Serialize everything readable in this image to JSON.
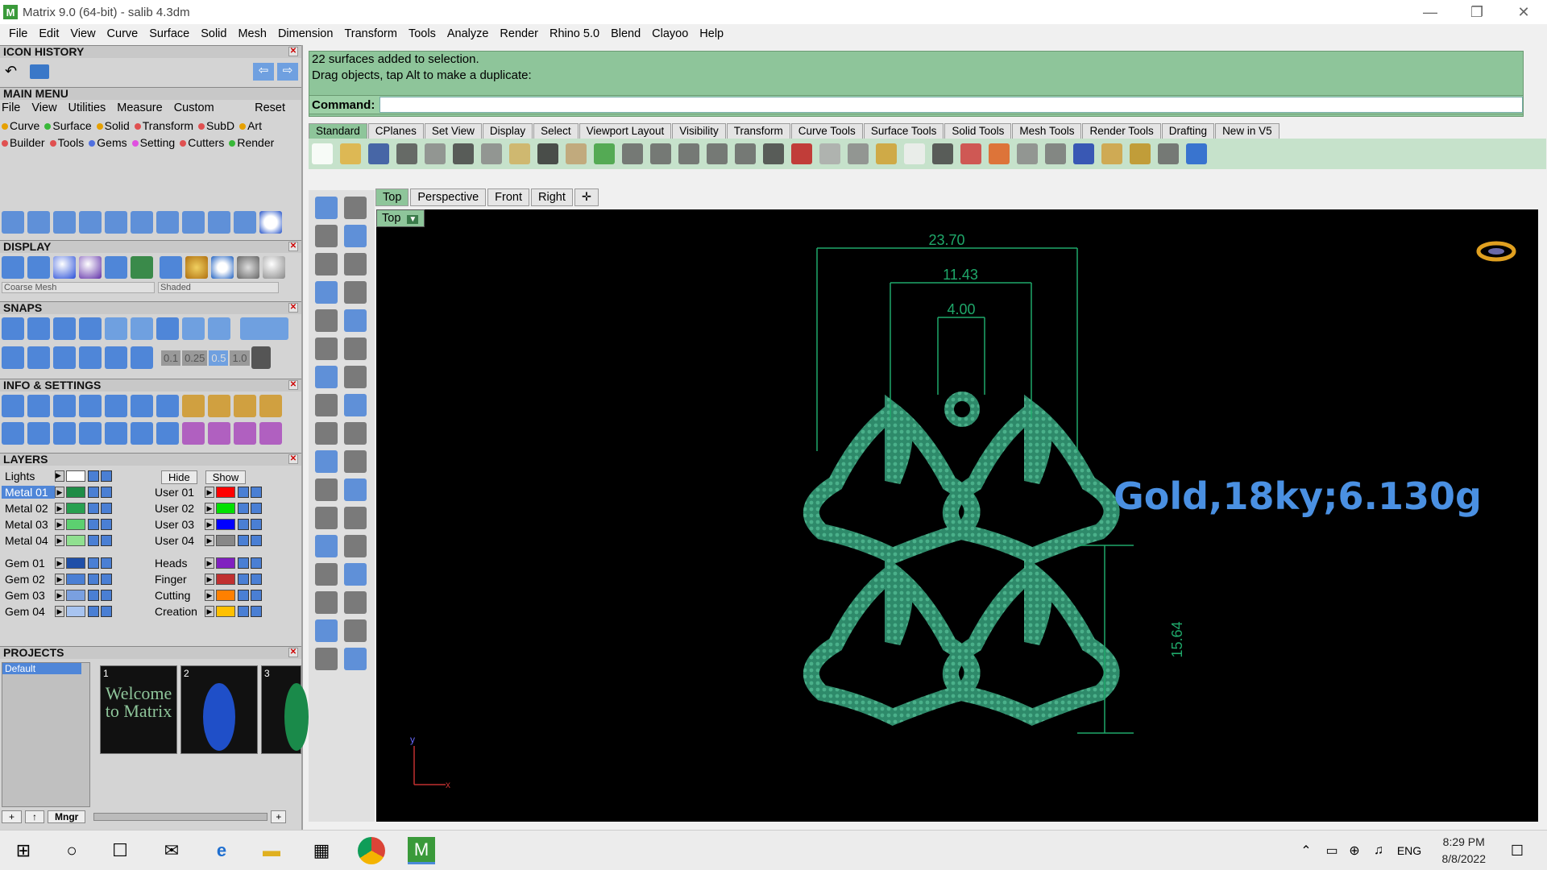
{
  "window": {
    "title": "Matrix 9.0 (64-bit) - salib 4.3dm",
    "minimize": "—",
    "restore": "❐",
    "close": "✕"
  },
  "menu": [
    "File",
    "Edit",
    "View",
    "Curve",
    "Surface",
    "Solid",
    "Mesh",
    "Dimension",
    "Transform",
    "Tools",
    "Analyze",
    "Render",
    "Rhino 5.0",
    "Blend",
    "Clayoo",
    "Help"
  ],
  "panels": {
    "icon_history": "ICON HISTORY",
    "main_menu": "MAIN MENU",
    "display": "DISPLAY",
    "snaps": "SNAPS",
    "info_settings": "INFO & SETTINGS",
    "layers": "LAYERS",
    "projects": "PROJECTS"
  },
  "main_menu_items": [
    "File",
    "View",
    "Utilities",
    "Measure",
    "Custom"
  ],
  "main_menu_reset": "Reset",
  "main_menu_categories_row1": [
    {
      "label": "Curve",
      "color": "#e6a000"
    },
    {
      "label": "Surface",
      "color": "#38b838"
    },
    {
      "label": "Solid",
      "color": "#e6a000"
    },
    {
      "label": "Transform",
      "color": "#e05050"
    },
    {
      "label": "SubD",
      "color": "#e05050"
    },
    {
      "label": "Art",
      "color": "#e6a000"
    }
  ],
  "main_menu_categories_row2": [
    {
      "label": "Builder",
      "color": "#e05050"
    },
    {
      "label": "Tools",
      "color": "#e05050"
    },
    {
      "label": "Gems",
      "color": "#5070e0"
    },
    {
      "label": "Setting",
      "color": "#e050e0"
    },
    {
      "label": "Cutters",
      "color": "#e05050"
    },
    {
      "label": "Render",
      "color": "#38b838"
    }
  ],
  "display": {
    "mesh_select": "Coarse Mesh",
    "mode_select": "Shaded"
  },
  "snaps": {
    "values": [
      "0.1",
      "0.25",
      "0.5",
      "1.0"
    ]
  },
  "layers": {
    "hide_label": "Hide",
    "show_label": "Show",
    "lights": {
      "name": "Lights",
      "color": "#ffffff"
    },
    "left": [
      {
        "name": "Metal 01",
        "color": "#1e8c46",
        "selected": true
      },
      {
        "name": "Metal 02",
        "color": "#28a050"
      },
      {
        "name": "Metal 03",
        "color": "#5cd070"
      },
      {
        "name": "Metal 04",
        "color": "#90e090"
      },
      {
        "name": "Gem 01",
        "color": "#1f4fa8"
      },
      {
        "name": "Gem 02",
        "color": "#4a7fd4"
      },
      {
        "name": "Gem 03",
        "color": "#7aa0e0"
      },
      {
        "name": "Gem 04",
        "color": "#a8c4f0"
      }
    ],
    "right": [
      {
        "name": "User 01",
        "color": "#ff0000"
      },
      {
        "name": "User 02",
        "color": "#00e000"
      },
      {
        "name": "User 03",
        "color": "#0000ff"
      },
      {
        "name": "User 04",
        "color": "#888888"
      },
      {
        "name": "Heads",
        "color": "#8020c0"
      },
      {
        "name": "Finger",
        "color": "#c03030"
      },
      {
        "name": "Cutting",
        "color": "#ff8000"
      },
      {
        "name": "Creation",
        "color": "#ffc000"
      }
    ]
  },
  "projects": {
    "list": [
      "Default"
    ],
    "thumb_numbers": [
      "1",
      "2",
      "3"
    ],
    "welcome_text": "Welcome to Matrix",
    "mngr": "Mngr"
  },
  "command": {
    "line1": "22 surfaces added to selection.",
    "line2": "Drag objects, tap Alt to make a duplicate:",
    "prompt": "Command:",
    "value": ""
  },
  "toolbar_tabs": [
    "Standard",
    "CPlanes",
    "Set View",
    "Display",
    "Select",
    "Viewport Layout",
    "Visibility",
    "Transform",
    "Curve Tools",
    "Surface Tools",
    "Solid Tools",
    "Mesh Tools",
    "Render Tools",
    "Drafting",
    "New in V5"
  ],
  "viewport_tabs": [
    "Top",
    "Perspective",
    "Front",
    "Right"
  ],
  "viewport": {
    "label": "Top",
    "dims": [
      "23.70",
      "11.43",
      "4.00",
      "15.64"
    ],
    "annotation": "Gold,18ky;6.130g",
    "axis_y": "y",
    "axis_x": "x"
  },
  "taskbar": {
    "time": "8:29 PM",
    "date": "8/8/2022",
    "lang": "ENG"
  },
  "colors": {
    "green_panel": "#8ec59a",
    "model_green": "#2e8a6a",
    "dim_green": "#1fa86a",
    "annotation_blue": "#4a90e2"
  }
}
